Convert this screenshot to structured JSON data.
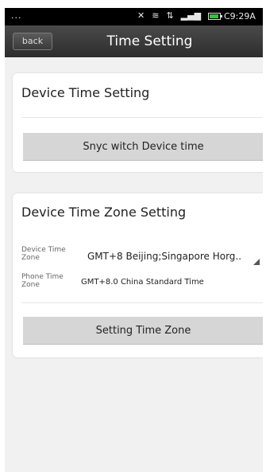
{
  "status_bar": {
    "dots": "...",
    "time": "C9:29A",
    "icons": [
      "mute-icon",
      "wifi-icon",
      "data-icon",
      "signal-icon",
      "battery-icon"
    ]
  },
  "title_bar": {
    "back_label": "back",
    "title": "Time Setting"
  },
  "device_time_card": {
    "title": "Device Time Setting",
    "sync_button": "Snyc witch Device time"
  },
  "time_zone_card": {
    "title": "Device Time Zone Setting",
    "device_tz_label": "Device Time Zone",
    "device_tz_value": "GMT+8 Beijing;Singapore Horg..",
    "phone_tz_label": "Phone Time Zone",
    "phone_tz_value": "GMT+8.0  China Standard Time",
    "setting_button": "Setting Time Zone"
  },
  "colors": {
    "title_bar": "#3a3a3a",
    "background": "#f1f1f1",
    "button": "#d6d6d6",
    "battery": "#35c23b"
  }
}
